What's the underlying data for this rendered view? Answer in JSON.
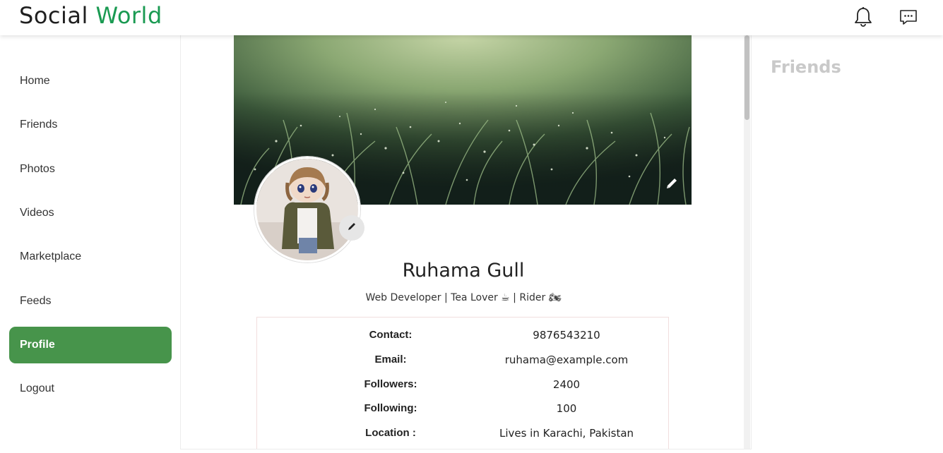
{
  "header": {
    "brand_part1": "Social",
    "brand_part2": "World",
    "brand_colors": {
      "primary": "#1f1f1f",
      "accent": "#1a9a52"
    },
    "icons": [
      "bell-icon",
      "chat-icon"
    ]
  },
  "sidebar": {
    "items": [
      {
        "label": "Home",
        "active": false
      },
      {
        "label": "Friends",
        "active": false
      },
      {
        "label": "Photos",
        "active": false
      },
      {
        "label": "Videos",
        "active": false
      },
      {
        "label": "Marketplace",
        "active": false
      },
      {
        "label": "Feeds",
        "active": false
      },
      {
        "label": "Profile",
        "active": true
      },
      {
        "label": "Logout",
        "active": false
      }
    ],
    "active_color": "#47944b"
  },
  "profile": {
    "name": "Ruhama Gull",
    "bio": "Web Developer | Tea Lover ☕ | Rider 🏍",
    "details": [
      {
        "label": "Contact:",
        "value": "9876543210"
      },
      {
        "label": "Email:",
        "value": "ruhama@example.com"
      },
      {
        "label": "Followers:",
        "value": "2400"
      },
      {
        "label": "Following:",
        "value": "100"
      },
      {
        "label": "Location :",
        "value": "Lives in Karachi, Pakistan"
      }
    ]
  },
  "right_panel": {
    "title": "Friends"
  }
}
